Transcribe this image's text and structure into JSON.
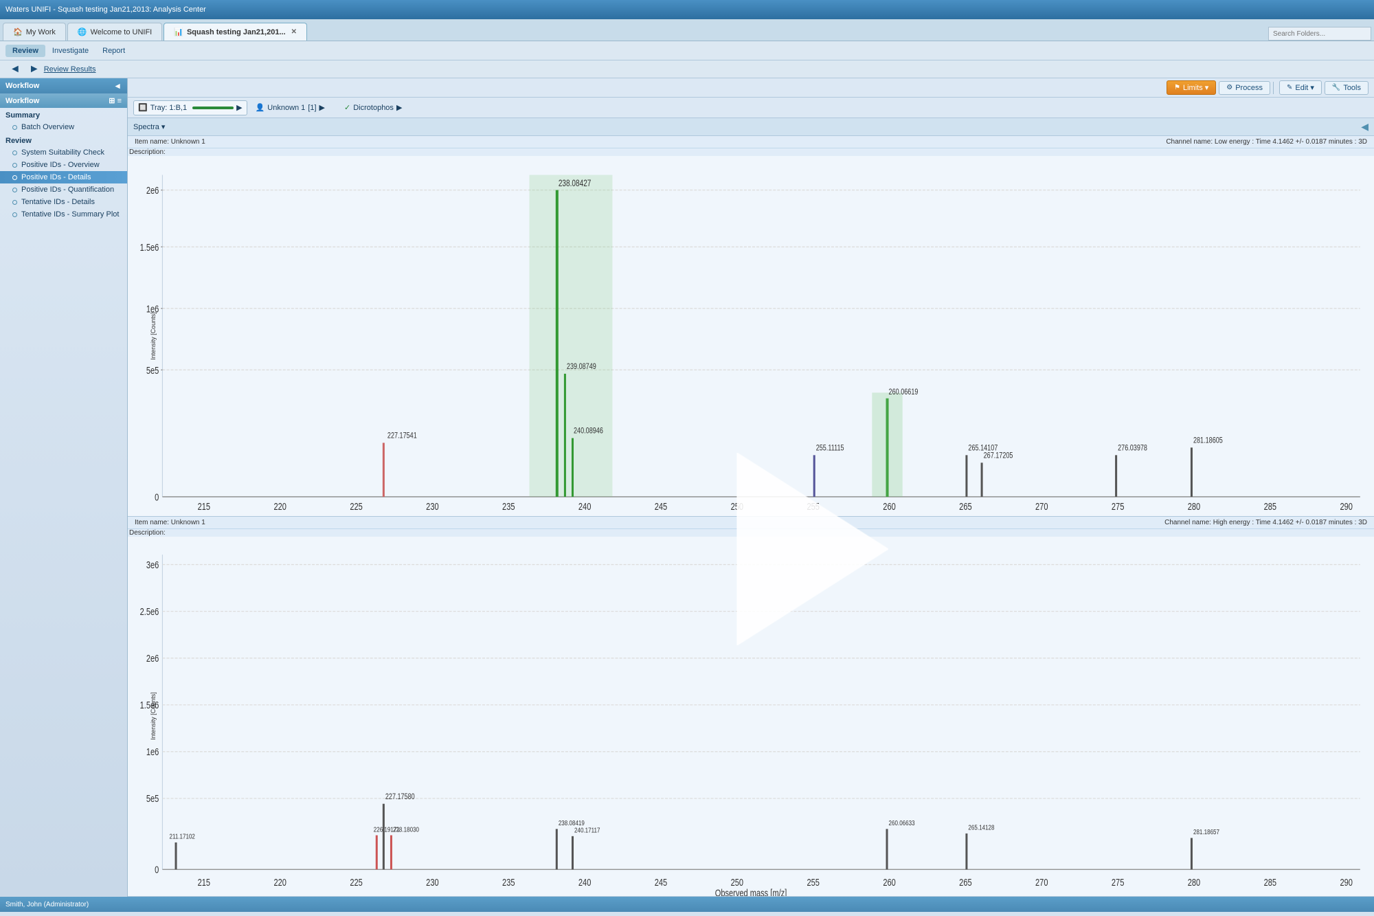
{
  "titlebar": {
    "title": "Waters UNIFI - Squash testing Jan21,2013: Analysis Center"
  },
  "tabs": [
    {
      "label": "My Work",
      "icon": "🏠",
      "active": false,
      "closable": false
    },
    {
      "label": "Welcome to UNIFI",
      "icon": "🌐",
      "active": false,
      "closable": false
    },
    {
      "label": "Squash testing Jan21,201...",
      "icon": "📊",
      "active": true,
      "closable": true
    }
  ],
  "search_placeholder": "Search Folders...",
  "menu": {
    "items": [
      "Review",
      "Investigate",
      "Report"
    ]
  },
  "navbar": {
    "back_icon": "◄",
    "forward_icon": "►",
    "label": "Review Results"
  },
  "sidebar": {
    "header": "Workflow",
    "workflow_label": "Workflow",
    "summary_section": "Summary",
    "summary_items": [
      {
        "label": "Batch Overview"
      }
    ],
    "review_section": "Review",
    "review_items": [
      {
        "label": "System Suitability Check",
        "active": false
      },
      {
        "label": "Positive IDs - Overview",
        "active": false
      },
      {
        "label": "Positive IDs - Details",
        "active": true
      },
      {
        "label": "Positive IDs - Quantification",
        "active": false
      },
      {
        "label": "Tentative IDs - Details",
        "active": false
      },
      {
        "label": "Tentative IDs - Summary Plot",
        "active": false
      }
    ]
  },
  "toolbar": {
    "limits_label": "Limits",
    "process_label": "Process",
    "edit_label": "Edit",
    "tools_label": "Tools"
  },
  "tray": {
    "label": "Tray: 1:B,1",
    "sample_label": "Unknown 1",
    "sample_index": "[1]",
    "compound_label": "Dicrotophos",
    "check_icon": "✓"
  },
  "spectra": {
    "dropdown_label": "Spectra"
  },
  "chart1": {
    "item_name": "Item name: Unknown 1",
    "description": "Description:",
    "channel_info": "Channel name: Low energy : Time 4.1462 +/- 0.0187 minutes : 3D",
    "y_axis": "Intensity [Counts]",
    "y_ticks": [
      "2e6",
      "1.5e6",
      "1e6",
      "5e5",
      "0"
    ],
    "x_ticks": [
      "215",
      "220",
      "225",
      "230",
      "235",
      "240",
      "245",
      "250",
      "255",
      "260",
      "265",
      "270",
      "275",
      "280",
      "285",
      "290"
    ],
    "peaks": [
      {
        "x": 227.17541,
        "label": "227.17541",
        "height": 0.15,
        "color": "#cc6666"
      },
      {
        "x": 238.08427,
        "label": "238.08427",
        "height": 0.9,
        "color": "#66aa66",
        "highlighted": true
      },
      {
        "x": 239.08749,
        "label": "239.08749",
        "height": 0.3,
        "color": "#66aa66"
      },
      {
        "x": 240.08946,
        "label": "240.08946",
        "height": 0.18,
        "color": "#66aa66"
      },
      {
        "x": 255.11115,
        "label": "255.11115",
        "height": 0.12
      },
      {
        "x": 260.06619,
        "label": "260.06619",
        "height": 0.25,
        "color": "#66aa66",
        "highlighted": true
      },
      {
        "x": 265.14107,
        "label": "265.14107",
        "height": 0.12
      },
      {
        "x": 267.17205,
        "label": "267.17205",
        "height": 0.1
      },
      {
        "x": 276.03978,
        "label": "276.03978",
        "height": 0.12
      },
      {
        "x": 281.18605,
        "label": "281.18605",
        "height": 0.15
      }
    ]
  },
  "chart2": {
    "item_name": "Item name: Unknown 1",
    "description": "Description:",
    "channel_info": "Channel name: High energy : Time 4.1462 +/- 0.0187 minutes : 3D",
    "y_axis": "Intensity [Counts]",
    "x_axis_label": "Observed mass [m/z]",
    "y_ticks": [
      "3e6",
      "2.5e6",
      "2e6",
      "1.5e6",
      "1e6",
      "5e5",
      "0"
    ],
    "x_ticks": [
      "215",
      "220",
      "225",
      "230",
      "235",
      "240",
      "245",
      "250",
      "255",
      "260",
      "265",
      "270",
      "275",
      "280",
      "285",
      "290"
    ],
    "peaks": [
      {
        "x": 211.17102,
        "label": "211.17102",
        "height": 0.08
      },
      {
        "x": 226.19171,
        "label": "226.19171",
        "height": 0.09,
        "color": "#cc6666"
      },
      {
        "x": 227.1758,
        "label": "227.17580",
        "height": 0.2
      },
      {
        "x": 228.1803,
        "label": "228.18030",
        "height": 0.1,
        "color": "#cc6666"
      },
      {
        "x": 238.08419,
        "label": "238.08419",
        "height": 0.12
      },
      {
        "x": 240.17117,
        "label": "240.17117",
        "height": 0.1
      },
      {
        "x": 260.06633,
        "label": "260.06633",
        "height": 0.12
      },
      {
        "x": 265.14128,
        "label": "265.14128",
        "height": 0.1
      },
      {
        "x": 281.18657,
        "label": "281.18657",
        "height": 0.09
      }
    ]
  },
  "statusbar": {
    "user": "Smith, John (Administrator)"
  }
}
